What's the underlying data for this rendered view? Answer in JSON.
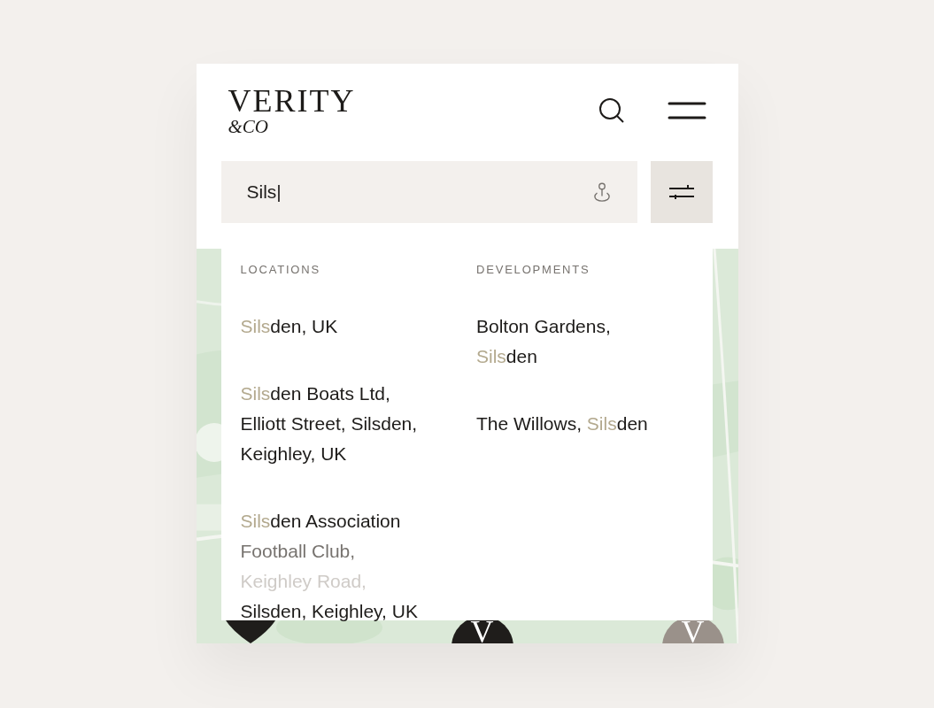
{
  "logo": {
    "name": "VERITY",
    "tagline": "&CO"
  },
  "search": {
    "value": "Sils|"
  },
  "results": [
    {
      "heading": "LOCATIONS",
      "items": [
        {
          "lines": [
            {
              "kind": "normal",
              "segments": [
                {
                  "text": "Sils",
                  "match": true
                },
                {
                  "text": "den, UK",
                  "match": false
                }
              ]
            }
          ]
        },
        {
          "lines": [
            {
              "kind": "normal",
              "segments": [
                {
                  "text": "Sils",
                  "match": true
                },
                {
                  "text": "den Boats Ltd,",
                  "match": false
                }
              ]
            },
            {
              "kind": "normal",
              "segments": [
                {
                  "text": "Elliott Street, Silsden,",
                  "match": false
                }
              ]
            },
            {
              "kind": "normal",
              "segments": [
                {
                  "text": "Keighley, UK",
                  "match": false
                }
              ]
            }
          ]
        },
        {
          "lines": [
            {
              "kind": "normal",
              "segments": [
                {
                  "text": "Sils",
                  "match": true
                },
                {
                  "text": "den Association",
                  "match": false
                }
              ]
            },
            {
              "kind": "muted",
              "segments": [
                {
                  "text": "Football Club,",
                  "match": false
                }
              ]
            },
            {
              "kind": "faint",
              "segments": [
                {
                  "text": "Keighley Road,",
                  "match": false
                }
              ]
            },
            {
              "kind": "normal",
              "segments": [
                {
                  "text": "Silsden, Keighley, UK",
                  "match": false
                }
              ]
            }
          ]
        }
      ]
    },
    {
      "heading": "DEVELOPMENTS",
      "items": [
        {
          "lines": [
            {
              "kind": "normal",
              "segments": [
                {
                  "text": "Bolton Gardens,",
                  "match": false
                }
              ]
            },
            {
              "kind": "normal",
              "segments": [
                {
                  "text": "Sils",
                  "match": true
                },
                {
                  "text": "den",
                  "match": false
                }
              ]
            }
          ]
        },
        {
          "lines": [
            {
              "kind": "normal",
              "segments": [
                {
                  "text": "The Willows, ",
                  "match": false
                },
                {
                  "text": "Sils",
                  "match": true
                },
                {
                  "text": "den",
                  "match": false
                }
              ]
            }
          ]
        }
      ]
    }
  ],
  "markers": [
    {
      "kind": "pin",
      "color": "#1f1d1b"
    },
    {
      "kind": "circle",
      "label": "V",
      "color": "#1f1d1b"
    },
    {
      "kind": "circle",
      "label": "V",
      "color": "#9a918a"
    }
  ]
}
